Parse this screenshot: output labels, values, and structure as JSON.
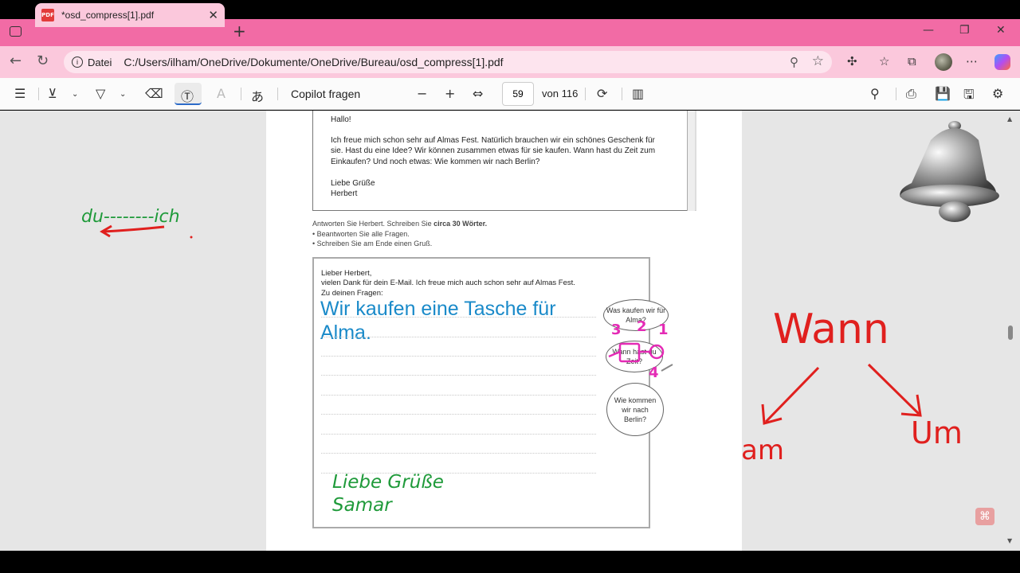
{
  "browser": {
    "tab_title": "*osd_compress[1].pdf",
    "address_label": "Datei",
    "url": "C:/Users/ilham/OneDrive/Dokumente/OneDrive/Bureau/osd_compress[1].pdf"
  },
  "toolbar": {
    "copilot_label": "Copilot fragen",
    "page_number": "59",
    "page_total": "von 116"
  },
  "letter": {
    "greeting": "Hallo!",
    "body_lines": [
      "Ich freue mich schon sehr auf Almas Fest. Natürlich brauchen wir ein schönes Geschenk für",
      "sie. Hast du eine Idee? Wir können zusammen etwas für sie kaufen. Wann hast du Zeit zum",
      "Einkaufen? Und noch etwas: Wie kommen wir nach Berlin?"
    ],
    "closing": "Liebe Grüße",
    "signature": "Herbert"
  },
  "instructions": {
    "line1_prefix": "Antworten Sie Herbert. Schreiben Sie ",
    "line1_bold": "circa 30 Wörter.",
    "bullet1": "• Beantworten Sie alle Fragen.",
    "bullet2": "• Schreiben Sie am Ende einen Gruß."
  },
  "answer": {
    "salutation": "Lieber Herbert,",
    "line2": "vielen Dank für dein E-Mail. Ich freue mich auch schon sehr auf Almas Fest.",
    "line3": "Zu deinen Fragen:",
    "typed_line1": "Wir kaufen eine  Tasche für",
    "typed_line2": "Alma.",
    "closing_line1": "Liebe Grüße",
    "closing_line2": "Samar"
  },
  "bubbles": {
    "q1": "Was kaufen wir für Alma?",
    "q2": "Wann hast du Zeit?",
    "q3": "Wie kommen wir nach Berlin?"
  },
  "annotations": {
    "du_ich": "du--------ich",
    "wann": "Wann",
    "am": "am",
    "um": "Um",
    "numbers": [
      "3",
      "2",
      "1",
      "4"
    ]
  },
  "colors": {
    "tab_bar": "#f26ba5",
    "address_bar": "#fbc8dc",
    "typed_text": "#1a8ac9",
    "handwriting_green": "#1f9a3a",
    "handwriting_red": "#e0201e",
    "handwriting_magenta": "#e42bb5"
  }
}
